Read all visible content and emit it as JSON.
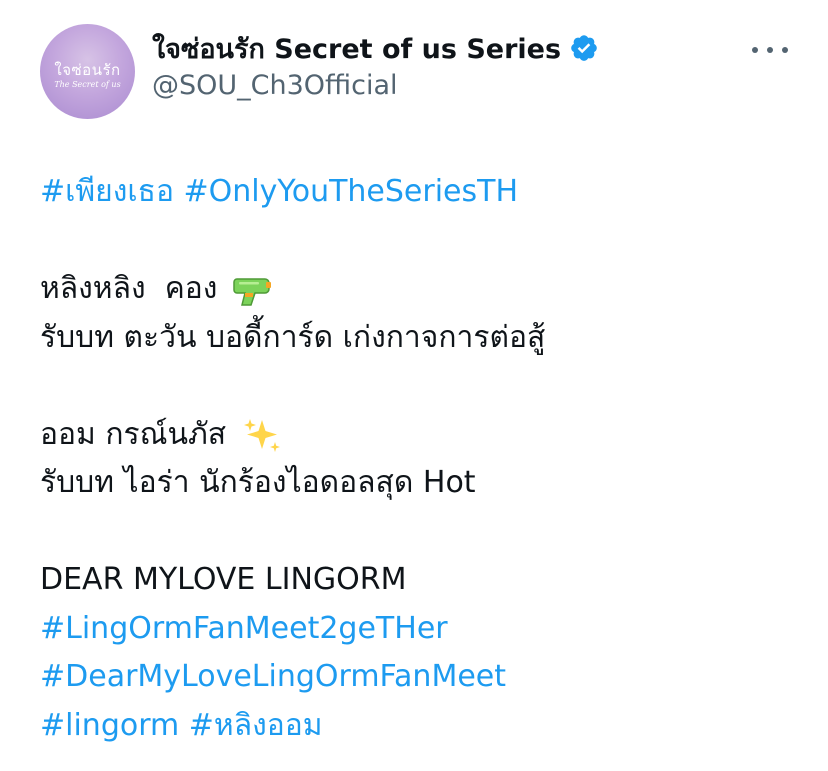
{
  "account": {
    "avatar_text": "ใจซ่อนรัก",
    "avatar_subtext": "The Secret of us",
    "display_name": "ใจซ่อนรัก Secret of us Series",
    "handle": "@SOU_Ch3Official",
    "verified": true,
    "verified_icon": "verified-badge-icon",
    "more_icon": "more-options-icon"
  },
  "tweet": {
    "hashtags_top": [
      "#เพียงเธอ",
      "#OnlyYouTheSeriesTH"
    ],
    "ling_name": "หลิงหลิง  คอง",
    "ling_emoji": "water-pistol-icon",
    "ling_role": "รับบท ตะวัน บอดี้การ์ด เก่งกาจการต่อสู้",
    "orm_name": "ออม กรณ์นภัส",
    "orm_emoji": "sparkles-icon",
    "orm_role": "รับบท ไอร่า นักร้องไอดอลสุด Hot",
    "dear_line": "DEAR MYLOVE LINGORM",
    "hashtags_bottom": [
      "#LingOrmFanMeet2geTHer",
      "#DearMyLoveLingOrmFanMeet",
      "#lingorm",
      "#หลิงออม"
    ]
  },
  "colors": {
    "link": "#1d9bf0",
    "text": "#0f1419",
    "secondary": "#536471",
    "verified": "#1d9bf0"
  }
}
